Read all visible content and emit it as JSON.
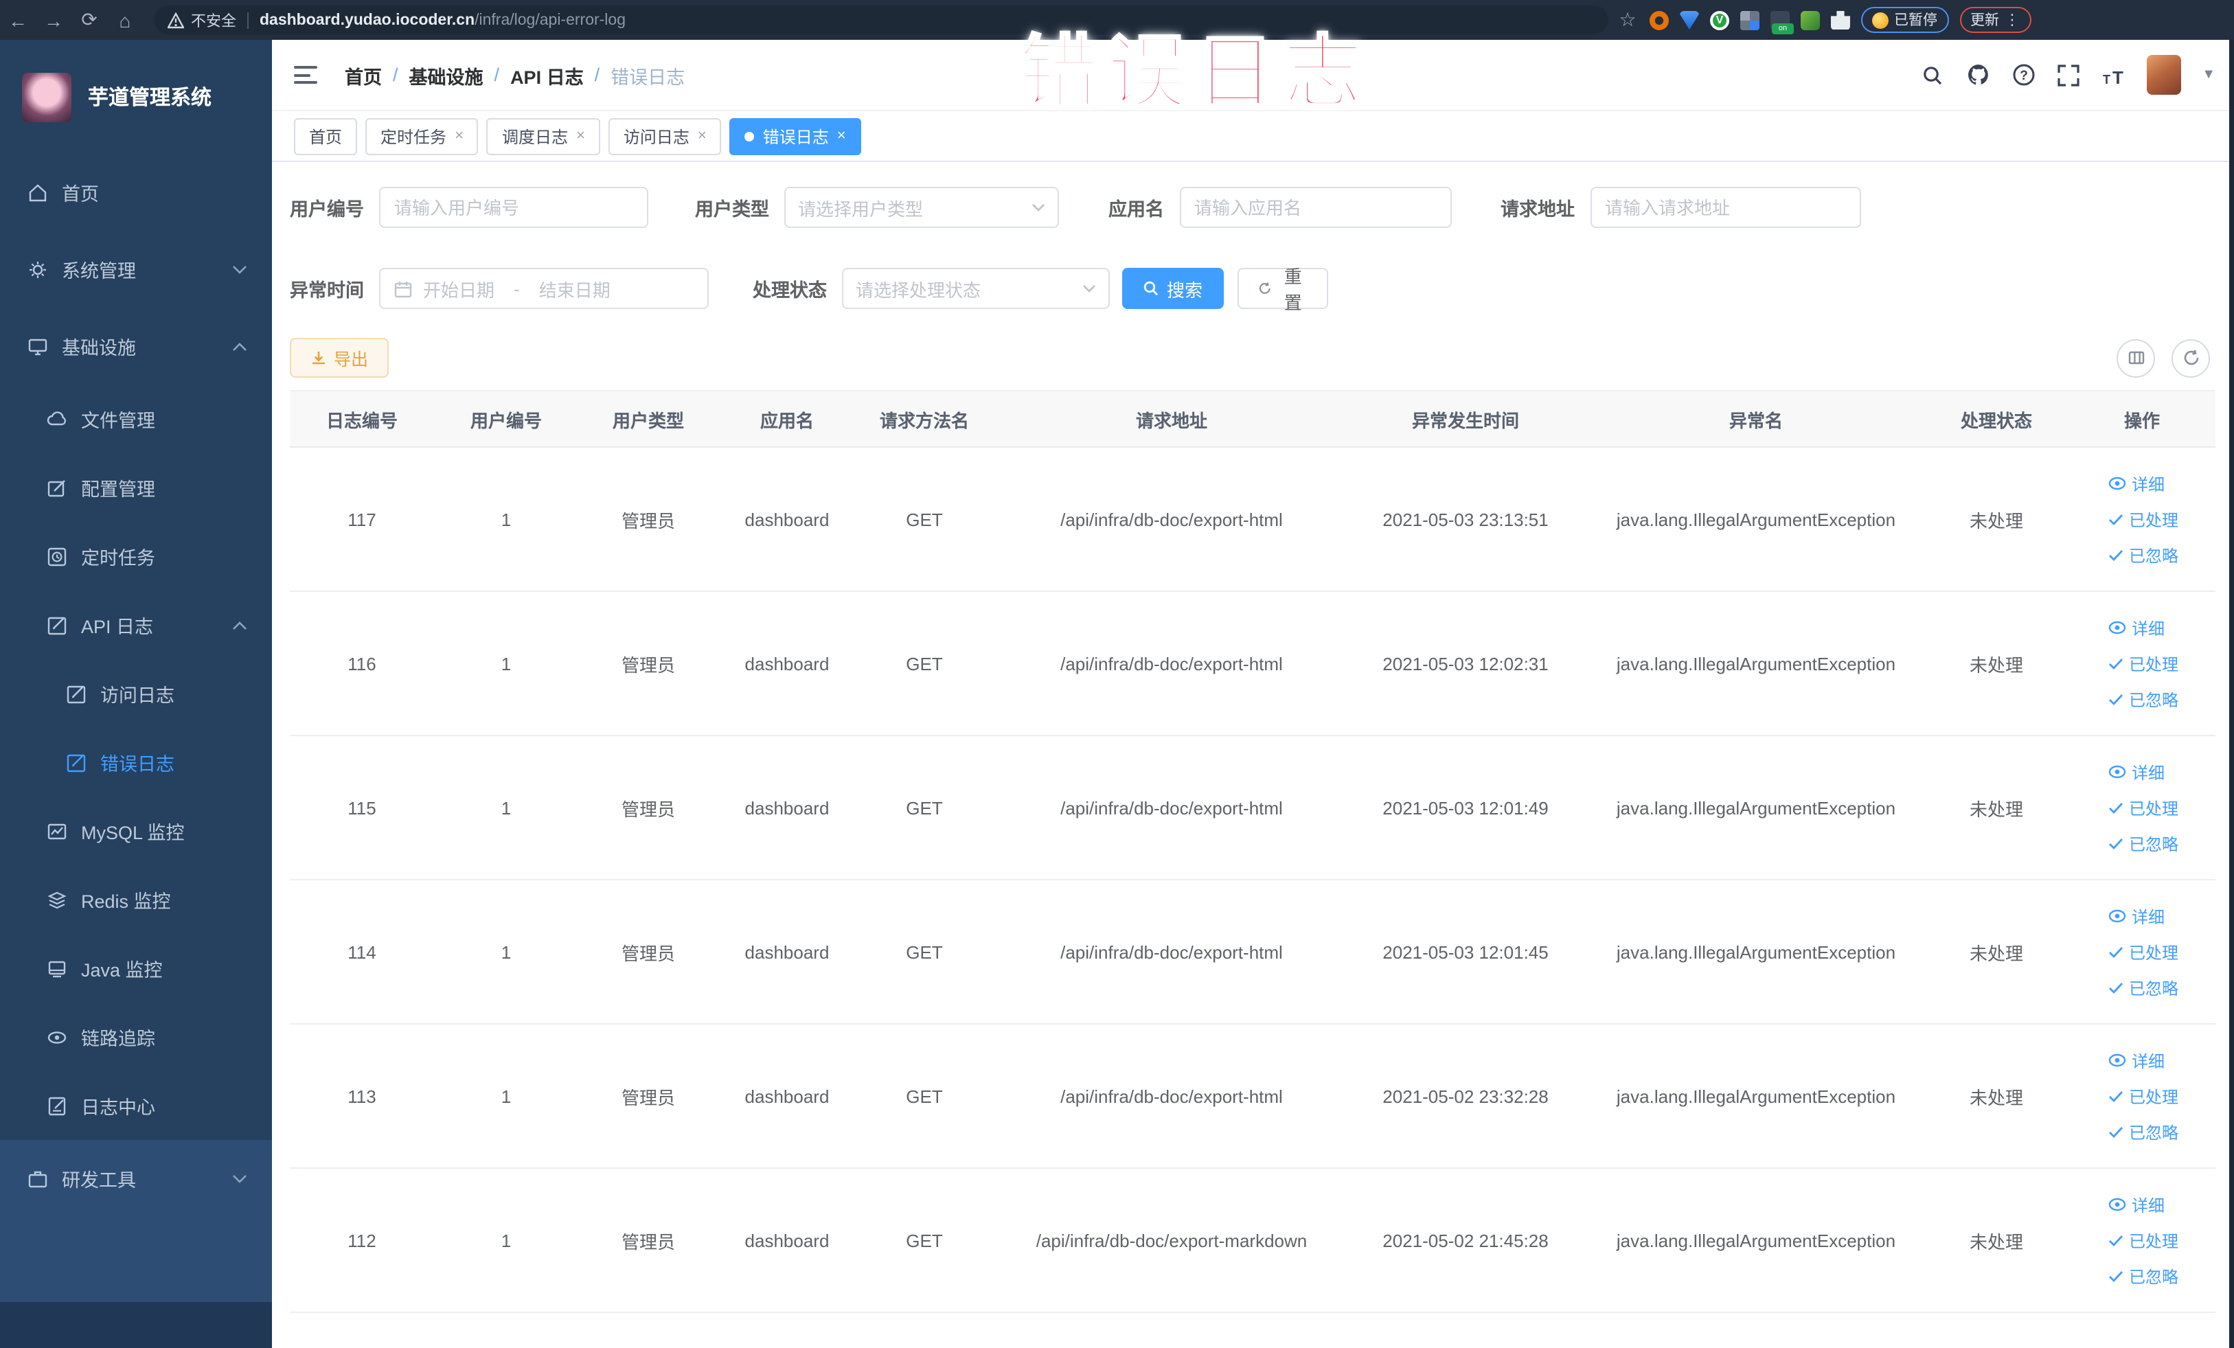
{
  "browser": {
    "security_label": "不安全",
    "url_host": "dashboard.yudao.iocoder.cn",
    "url_path": "/infra/log/api-error-log",
    "profile_chip": "已暂停",
    "update_chip": "更新",
    "kebab": "⋮"
  },
  "overlay": {
    "text": "错误日志",
    "color": "#ed3f61"
  },
  "colors": {
    "accent": "#409eff",
    "warning": "#e6a23c",
    "sidebar_bg": "#26405f",
    "sidebar_light_bg": "#2e4d74"
  },
  "sidebar": {
    "title": "芋道管理系统",
    "items": [
      {
        "label": "首页",
        "icon": "home-icon",
        "level": 1
      },
      {
        "label": "系统管理",
        "icon": "gear-icon",
        "level": 1,
        "chevron": "down"
      },
      {
        "label": "基础设施",
        "icon": "infra-icon",
        "level": 1,
        "chevron": "up"
      },
      {
        "label": "文件管理",
        "icon": "file-manage-icon",
        "level": 2
      },
      {
        "label": "配置管理",
        "icon": "config-icon",
        "level": 2
      },
      {
        "label": "定时任务",
        "icon": "job-icon",
        "level": 2
      },
      {
        "label": "API 日志",
        "icon": "api-log-icon",
        "level": 2,
        "chevron": "up"
      },
      {
        "label": "访问日志",
        "icon": "access-log-icon",
        "level": 3
      },
      {
        "label": "错误日志",
        "icon": "error-log-icon",
        "level": 3,
        "active": true
      },
      {
        "label": "MySQL 监控",
        "icon": "mysql-icon",
        "level": 2
      },
      {
        "label": "Redis 监控",
        "icon": "redis-icon",
        "level": 2
      },
      {
        "label": "Java 监控",
        "icon": "java-icon",
        "level": 2
      },
      {
        "label": "链路追踪",
        "icon": "trace-icon",
        "level": 2
      },
      {
        "label": "日志中心",
        "icon": "log-center-icon",
        "level": 2
      },
      {
        "label": "研发工具",
        "icon": "devtools-icon",
        "level": 1,
        "chevron": "down",
        "section": "light"
      }
    ]
  },
  "breadcrumb": {
    "items": [
      "首页",
      "基础设施",
      "API 日志",
      "错误日志"
    ],
    "separator": "/"
  },
  "tabs": [
    {
      "label": "首页",
      "closable": false,
      "active": false
    },
    {
      "label": "定时任务",
      "closable": true,
      "active": false
    },
    {
      "label": "调度日志",
      "closable": true,
      "active": false
    },
    {
      "label": "访问日志",
      "closable": true,
      "active": false
    },
    {
      "label": "错误日志",
      "closable": true,
      "active": true
    }
  ],
  "filters": {
    "user_id": {
      "label": "用户编号",
      "placeholder": "请输入用户编号"
    },
    "user_type": {
      "label": "用户类型",
      "placeholder": "请选择用户类型"
    },
    "app_name": {
      "label": "应用名",
      "placeholder": "请输入应用名"
    },
    "request_url": {
      "label": "请求地址",
      "placeholder": "请输入请求地址"
    },
    "exception_time": {
      "label": "异常时间",
      "start_placeholder": "开始日期",
      "separator": "-",
      "end_placeholder": "结束日期"
    },
    "process_status": {
      "label": "处理状态",
      "placeholder": "请选择处理状态"
    },
    "search_button": "搜索",
    "reset_button": "重置"
  },
  "toolbar": {
    "export_button": "导出"
  },
  "table": {
    "columns": [
      "日志编号",
      "用户编号",
      "用户类型",
      "应用名",
      "请求方法名",
      "请求地址",
      "异常发生时间",
      "异常名",
      "处理状态",
      "操作"
    ],
    "action_labels": {
      "detail": "详细",
      "processed": "已处理",
      "ignored": "已忽略"
    },
    "rows": [
      {
        "id": "117",
        "user_id": "1",
        "user_type": "管理员",
        "app": "dashboard",
        "method": "GET",
        "url": "/api/infra/db-doc/export-html",
        "time": "2021-05-03 23:13:51",
        "exception": "java.lang.IllegalArgumentException",
        "status": "未处理"
      },
      {
        "id": "116",
        "user_id": "1",
        "user_type": "管理员",
        "app": "dashboard",
        "method": "GET",
        "url": "/api/infra/db-doc/export-html",
        "time": "2021-05-03 12:02:31",
        "exception": "java.lang.IllegalArgumentException",
        "status": "未处理"
      },
      {
        "id": "115",
        "user_id": "1",
        "user_type": "管理员",
        "app": "dashboard",
        "method": "GET",
        "url": "/api/infra/db-doc/export-html",
        "time": "2021-05-03 12:01:49",
        "exception": "java.lang.IllegalArgumentException",
        "status": "未处理"
      },
      {
        "id": "114",
        "user_id": "1",
        "user_type": "管理员",
        "app": "dashboard",
        "method": "GET",
        "url": "/api/infra/db-doc/export-html",
        "time": "2021-05-03 12:01:45",
        "exception": "java.lang.IllegalArgumentException",
        "status": "未处理"
      },
      {
        "id": "113",
        "user_id": "1",
        "user_type": "管理员",
        "app": "dashboard",
        "method": "GET",
        "url": "/api/infra/db-doc/export-html",
        "time": "2021-05-02 23:32:28",
        "exception": "java.lang.IllegalArgumentException",
        "status": "未处理"
      },
      {
        "id": "112",
        "user_id": "1",
        "user_type": "管理员",
        "app": "dashboard",
        "method": "GET",
        "url": "/api/infra/db-doc/export-markdown",
        "time": "2021-05-02 21:45:28",
        "exception": "java.lang.IllegalArgumentException",
        "status": "未处理"
      }
    ]
  }
}
